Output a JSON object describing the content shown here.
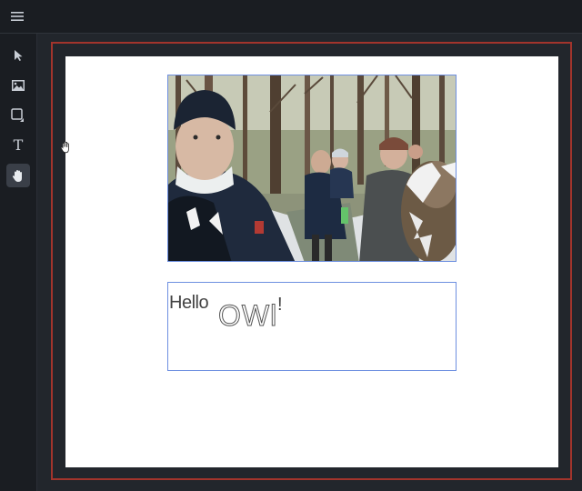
{
  "toolbar": {
    "menu_icon": "menu-icon"
  },
  "tools": [
    {
      "id": "select",
      "icon": "pointer-icon",
      "active": false
    },
    {
      "id": "image",
      "icon": "image-icon",
      "active": false
    },
    {
      "id": "shape",
      "icon": "square-icon",
      "active": false
    },
    {
      "id": "text",
      "icon": "text-icon",
      "label": "T",
      "active": false
    },
    {
      "id": "pan",
      "icon": "hand-icon",
      "active": true
    }
  ],
  "canvas": {
    "frame_color": "#a2342c",
    "selection_color": "#6d8fe0",
    "text_box": {
      "word1": "Hello",
      "word2": "OWl",
      "word3": "!"
    }
  }
}
